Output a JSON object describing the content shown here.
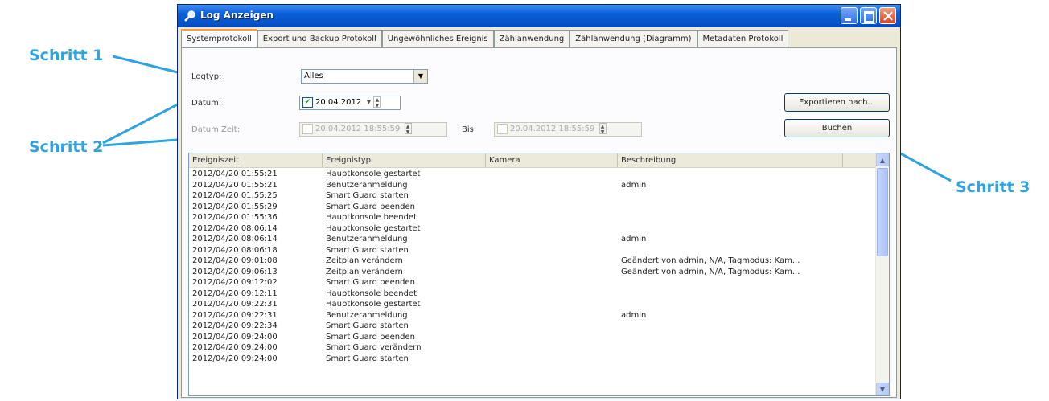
{
  "annotations": {
    "step1": "Schritt 1",
    "step2": "Schritt 2",
    "step3": "Schritt 3",
    "color": "#2ea3e0"
  },
  "window": {
    "title": "Log Anzeigen"
  },
  "tabs": [
    {
      "label": "Systemprotokoll",
      "active": true
    },
    {
      "label": "Export und Backup Protokoll",
      "active": false
    },
    {
      "label": "Ungewöhnliches Ereignis",
      "active": false
    },
    {
      "label": "Zählanwendung",
      "active": false
    },
    {
      "label": "Zählanwendung (Diagramm)",
      "active": false
    },
    {
      "label": "Metadaten Protokoll",
      "active": false
    }
  ],
  "form": {
    "logtype_label": "Logtyp:",
    "logtype_value": "Alles",
    "date_label": "Datum:",
    "date_value": "20.04.2012",
    "datetime_label": "Datum Zeit:",
    "datetime_from": "20.04.2012 18:55:59",
    "bis_label": "Bis",
    "datetime_to": "20.04.2012 18:55:59",
    "export_button": "Exportieren nach...",
    "search_button": "Buchen"
  },
  "list": {
    "headers": [
      "Ereigniszeit",
      "Ereignistyp",
      "Kamera",
      "Beschreibung"
    ],
    "rows": [
      [
        "2012/04/20 01:55:21",
        "Hauptkonsole gestartet",
        "",
        ""
      ],
      [
        "2012/04/20 01:55:21",
        "Benutzeranmeldung",
        "",
        "admin"
      ],
      [
        "2012/04/20 01:55:25",
        "Smart Guard starten",
        "",
        ""
      ],
      [
        "2012/04/20 01:55:29",
        "Smart Guard beenden",
        "",
        ""
      ],
      [
        "2012/04/20 01:55:36",
        "Hauptkonsole beendet",
        "",
        ""
      ],
      [
        "2012/04/20 08:06:14",
        "Hauptkonsole gestartet",
        "",
        ""
      ],
      [
        "2012/04/20 08:06:14",
        "Benutzeranmeldung",
        "",
        "admin"
      ],
      [
        "2012/04/20 08:06:18",
        "Smart Guard starten",
        "",
        ""
      ],
      [
        "2012/04/20 09:01:08",
        "Zeitplan verändern",
        "",
        "Geändert von admin, N/A, Tagmodus: Kam..."
      ],
      [
        "2012/04/20 09:06:13",
        "Zeitplan verändern",
        "",
        "Geändert von admin, N/A, Tagmodus: Kam..."
      ],
      [
        "2012/04/20 09:12:02",
        "Smart Guard beenden",
        "",
        ""
      ],
      [
        "2012/04/20 09:12:11",
        "Hauptkonsole beendet",
        "",
        ""
      ],
      [
        "2012/04/20 09:22:31",
        "Hauptkonsole gestartet",
        "",
        ""
      ],
      [
        "2012/04/20 09:22:31",
        "Benutzeranmeldung",
        "",
        "admin"
      ],
      [
        "2012/04/20 09:22:34",
        "Smart Guard starten",
        "",
        ""
      ],
      [
        "2012/04/20 09:24:00",
        "Smart Guard beenden",
        "",
        ""
      ],
      [
        "2012/04/20 09:24:00",
        "Smart Guard verändern",
        "",
        ""
      ],
      [
        "2012/04/20 09:24:00",
        "Smart Guard starten",
        "",
        ""
      ]
    ]
  }
}
